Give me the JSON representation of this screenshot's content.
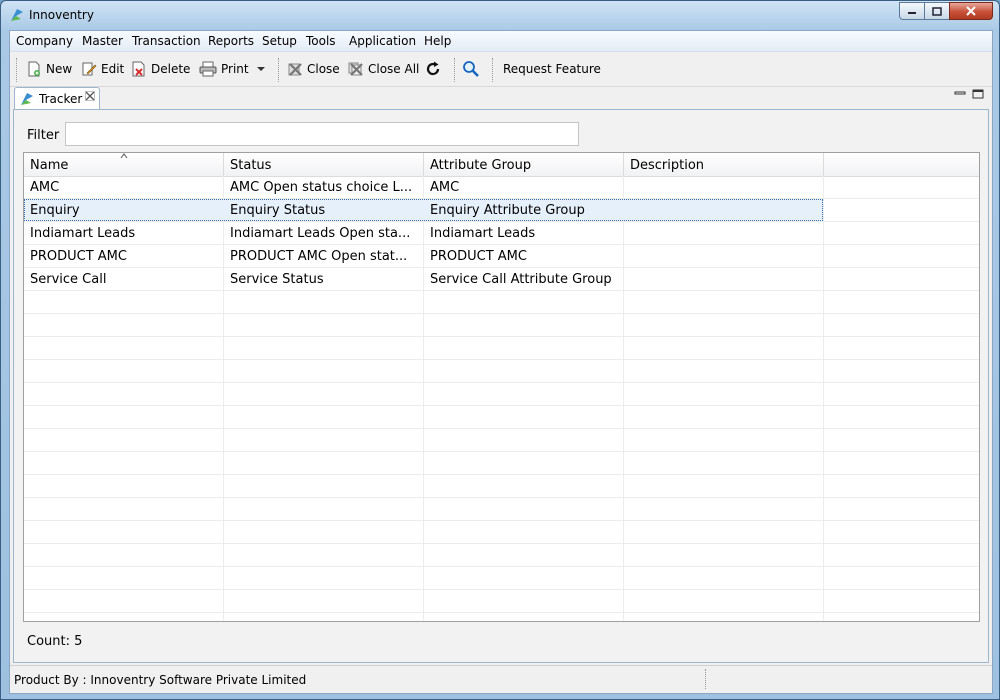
{
  "window": {
    "title": "Innoventry"
  },
  "menu": [
    "Company",
    "Master",
    "Transaction",
    "Reports",
    "Setup",
    "Tools",
    "Application",
    "Help"
  ],
  "toolbar": {
    "new": "New",
    "edit": "Edit",
    "delete": "Delete",
    "print": "Print",
    "close": "Close",
    "close_all": "Close All",
    "request_feature": "Request Feature"
  },
  "tab": {
    "label": "Tracker"
  },
  "filter": {
    "label": "Filter",
    "value": "",
    "placeholder": ""
  },
  "table": {
    "columns": [
      "Name",
      "Status",
      "Attribute Group",
      "Description"
    ],
    "rows": [
      {
        "name": "AMC",
        "status": "AMC Open status choice L...",
        "attribute_group": "AMC",
        "description": ""
      },
      {
        "name": "Enquiry",
        "status": "Enquiry Status",
        "attribute_group": "Enquiry Attribute Group",
        "description": ""
      },
      {
        "name": "Indiamart Leads",
        "status": "Indiamart Leads  Open sta...",
        "attribute_group": "Indiamart Leads",
        "description": ""
      },
      {
        "name": "PRODUCT AMC",
        "status": "PRODUCT AMC Open stat...",
        "attribute_group": "PRODUCT AMC",
        "description": ""
      },
      {
        "name": "Service Call",
        "status": "Service Status",
        "attribute_group": "Service Call Attribute Group",
        "description": ""
      }
    ],
    "selected_row": "Enquiry"
  },
  "count": "Count: 5",
  "status_bar": {
    "text": "Product By : Innoventry Software Private Limited"
  },
  "colors": {
    "accent": "#3a6ea5",
    "selection": "#e5f0fb",
    "close_button": "#c7513a"
  },
  "icons": [
    "app-icon",
    "new-icon",
    "edit-icon",
    "delete-icon",
    "print-icon",
    "dropdown-arrow-icon",
    "close-icon",
    "close-all-icon",
    "refresh-icon",
    "search-icon",
    "tab-icon",
    "tab-close-icon"
  ]
}
